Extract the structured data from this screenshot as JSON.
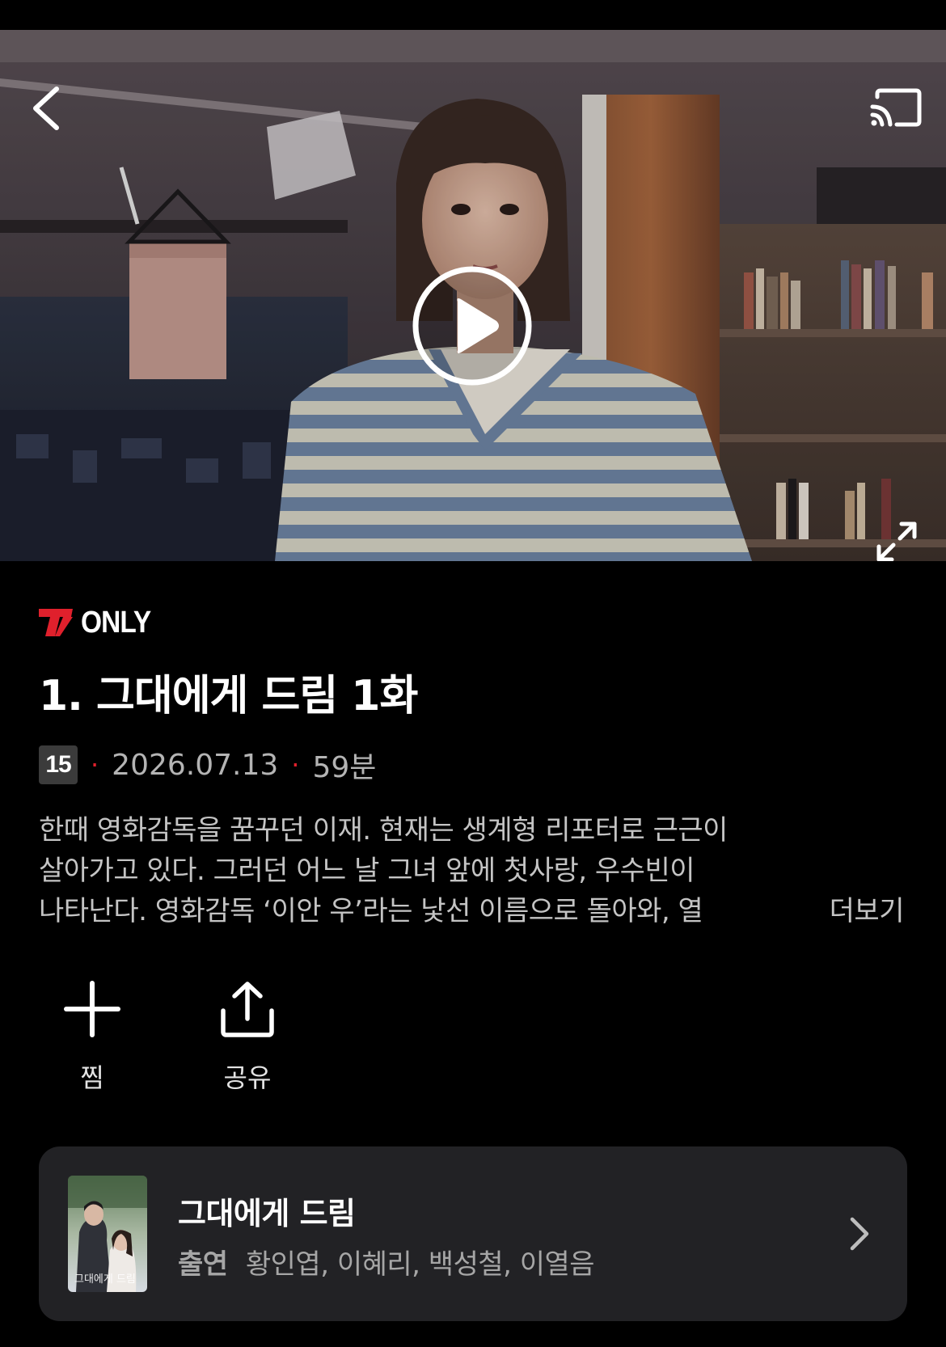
{
  "player": {
    "back_icon": "chevron-left-icon",
    "cast_icon": "cast-icon",
    "play_icon": "play-circle-icon",
    "fullscreen_icon": "expand-icon"
  },
  "brand": {
    "logo_letter": "T",
    "label": "ONLY",
    "logo_color": "#e0202c"
  },
  "episode": {
    "title": "1. 그대에게 드림 1화",
    "rating": "15",
    "date": "2026.07.13",
    "duration": "59분",
    "dot": "·",
    "description_lines": [
      "한때 영화감독을 꿈꾸던 이재. 현재는 생계형 리포터로 근근이",
      "살아가고 있다. 그러던 어느 날 그녀 앞에 첫사랑, 우수빈이",
      "나타난다. 영화감독 ‘이안 우’라는 낯선 이름으로 돌아와, 열"
    ],
    "more_label": "더보기"
  },
  "actions": {
    "zzim_label": "찜",
    "share_label": "공유"
  },
  "series": {
    "title": "그대에게 드림",
    "cast_label": "출연",
    "cast_names": "황인엽, 이혜리, 백성철, 이열음",
    "poster_text": "그대에게 드림"
  },
  "colors": {
    "accent": "#e0202c",
    "background": "#000000",
    "card": "#222225"
  }
}
